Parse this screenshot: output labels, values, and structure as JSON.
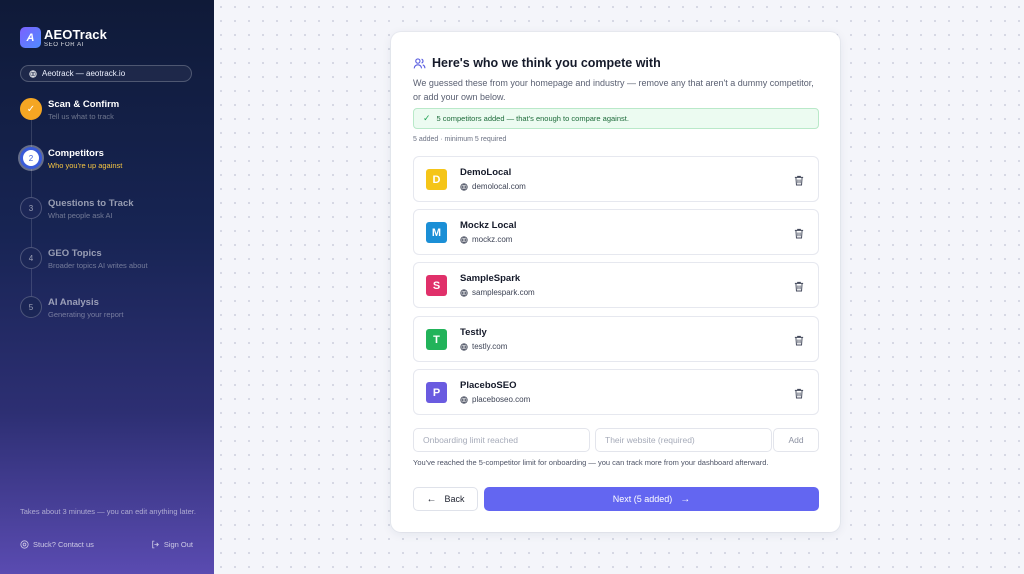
{
  "brand": {
    "name": "AEOTrack",
    "tagline": "SEO FOR AI",
    "logo_glyph": "A"
  },
  "site_pill": {
    "label": "Aeotrack — aeotrack.io"
  },
  "steps": [
    {
      "number": "✓",
      "title": "Scan & Confirm",
      "subtitle": "Tell us what to track",
      "state": "done"
    },
    {
      "number": "2",
      "title": "Competitors",
      "subtitle": "Who you're up against",
      "state": "active"
    },
    {
      "number": "3",
      "title": "Questions to Track",
      "subtitle": "What people ask AI",
      "state": "todo"
    },
    {
      "number": "4",
      "title": "GEO Topics",
      "subtitle": "Broader topics AI writes about",
      "state": "todo"
    },
    {
      "number": "5",
      "title": "AI Analysis",
      "subtitle": "Generating your report",
      "state": "todo"
    }
  ],
  "sidebar_footer": {
    "note": "Takes about 3 minutes — you can edit anything later.",
    "contact": "Stuck? Contact us",
    "signout": "Sign Out"
  },
  "card": {
    "title": "Here's who we think you compete with",
    "description": "We guessed these from your homepage and industry — remove any that aren't a dummy competitor, or add your own below.",
    "success_message": "5 competitors added — that's enough to compare against.",
    "count_note": "5 added · minimum 5 required"
  },
  "competitors": [
    {
      "letter": "D",
      "name": "DemoLocal",
      "domain": "demolocal.com",
      "color": "#f5c518"
    },
    {
      "letter": "M",
      "name": "Mockz Local",
      "domain": "mockz.com",
      "color": "#1b8fd6"
    },
    {
      "letter": "S",
      "name": "SampleSpark",
      "domain": "samplespark.com",
      "color": "#e0306a"
    },
    {
      "letter": "T",
      "name": "Testly",
      "domain": "testly.com",
      "color": "#22b35a"
    },
    {
      "letter": "P",
      "name": "PlaceboSEO",
      "domain": "placeboseo.com",
      "color": "#6a5be0"
    }
  ],
  "add_form": {
    "name_placeholder": "Onboarding limit reached",
    "website_placeholder": "Their website (required)",
    "add_label": "Add"
  },
  "limit_note": "You've reached the 5-competitor limit for onboarding — you can track more from your dashboard afterward.",
  "nav": {
    "back_label": "Back",
    "next_label": "Next (5 added)"
  },
  "colors": {
    "accent": "#6366f1",
    "done_step": "#f5a623",
    "success_bg": "#ecfbf1"
  }
}
